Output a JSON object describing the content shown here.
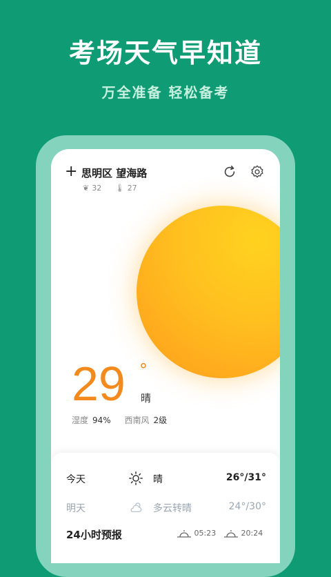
{
  "promo": {
    "headline": "考场天气早知道",
    "subline": "万全准备 轻松备考"
  },
  "colors": {
    "background": "#0f9b74",
    "frame": "#84d3bd",
    "accent_temp": "#f28a1e",
    "sun": "#ffbf1f"
  },
  "header": {
    "add_icon": "plus-icon",
    "location": "思明区 望海路",
    "refresh_icon": "refresh-icon",
    "settings_icon": "gear-icon",
    "aqi": "32",
    "feels": "27"
  },
  "current": {
    "temperature": "29",
    "degree_symbol": "°",
    "condition": "晴",
    "humidity_label": "湿度",
    "humidity_value": "94%",
    "wind_label": "西南风",
    "wind_value": "2级"
  },
  "daily": [
    {
      "day": "今天",
      "icon": "sun-icon",
      "condition": "晴",
      "range": "26°/31°"
    },
    {
      "day": "明天",
      "icon": "partly-cloudy-icon",
      "condition": "多云转晴",
      "range": "24°/30°"
    }
  ],
  "hourly": {
    "title": "24小时预报",
    "sunrise": "05:23",
    "sunset": "20:24"
  }
}
